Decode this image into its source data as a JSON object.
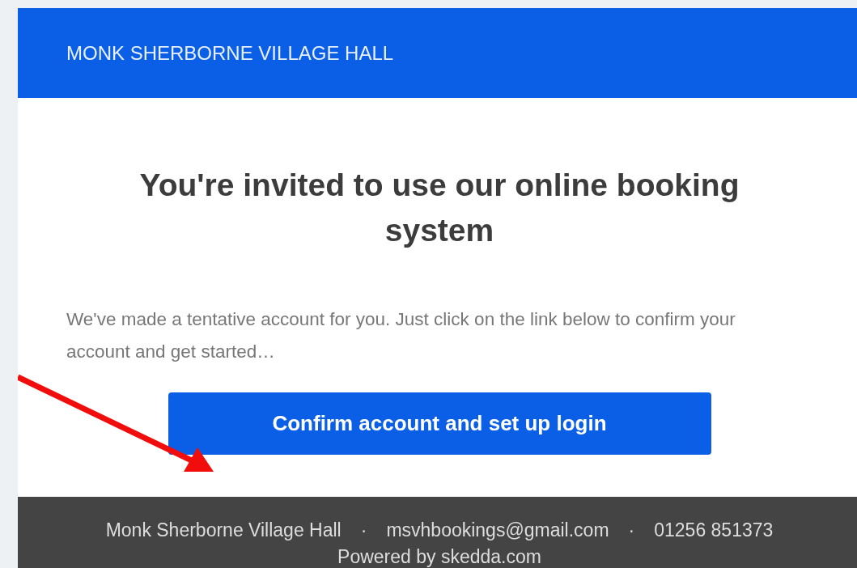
{
  "header": {
    "title": "MONK SHERBORNE VILLAGE HALL"
  },
  "heading": "You're invited to use our online booking system",
  "message": "We've made a tentative account for you. Just click on the link below to confirm your account and get started…",
  "button": "Confirm account and set up login",
  "footer": {
    "items": [
      "Monk Sherborne Village Hall",
      "msvhbookings@gmail.com",
      "01256 851373"
    ],
    "separator": "·",
    "powered_by": "Powered by skedda.com"
  },
  "annotation": {
    "kind": "arrow"
  }
}
